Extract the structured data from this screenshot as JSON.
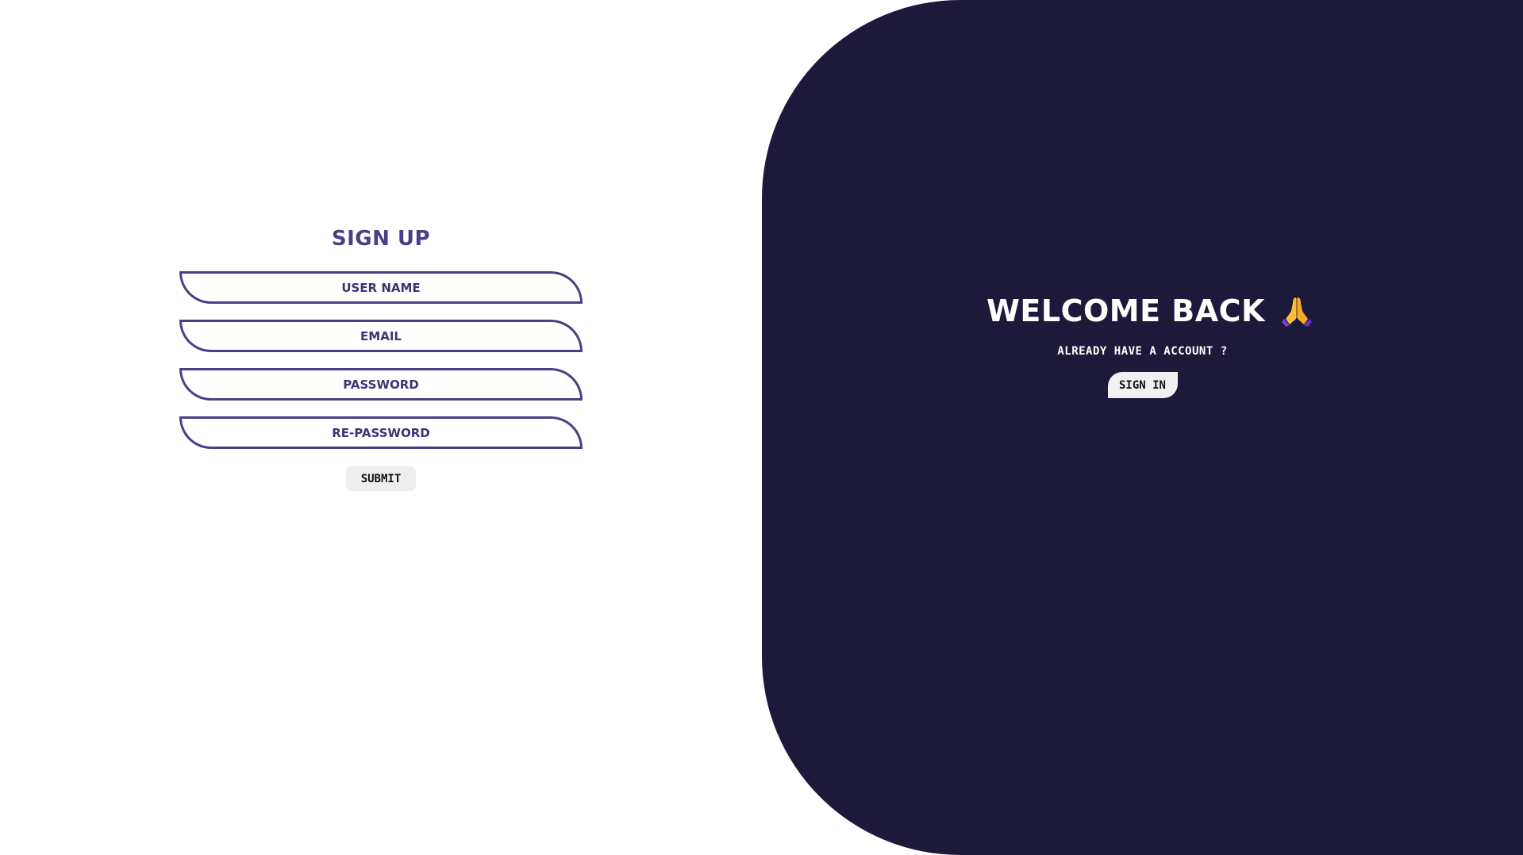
{
  "signup": {
    "title": "SIGN UP",
    "fields": [
      {
        "placeholder": "USER NAME"
      },
      {
        "placeholder": "EMAIL"
      },
      {
        "placeholder": "PASSWORD"
      },
      {
        "placeholder": "RE-PASSWORD"
      }
    ],
    "submit_label": "SUBMIT"
  },
  "welcome": {
    "title": "WELCOME BACK",
    "icon": "folded-hands-icon",
    "subtitle": "ALREADY HAVE A ACCOUNT ?",
    "signin_label": "SIGN IN"
  },
  "colors": {
    "accent": "#4a3f86",
    "panel_background": "#1d193b",
    "button_background": "#eeeef0",
    "page_background": "#ffffff"
  }
}
